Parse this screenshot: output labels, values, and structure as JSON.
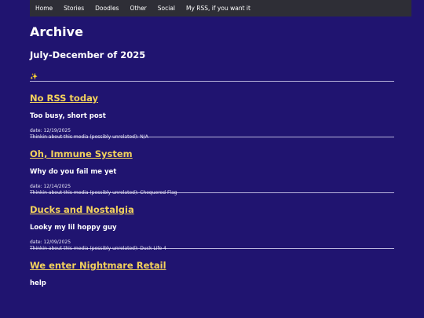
{
  "nav": [
    "Home",
    "Stories",
    "Doodles",
    "Other",
    "Social",
    "My RSS, if you want it"
  ],
  "page": {
    "title": "Archive",
    "subtitle": "July-December of 2025",
    "sparkle": "✨"
  },
  "posts": [
    {
      "title": "No RSS today",
      "subtitle": "Too busy, short post",
      "date": "date: 12/19/2025",
      "media": "Thinkin about this media (possibly unrelated): N/A"
    },
    {
      "title": "Oh, Immune System",
      "subtitle": "Why do you fail me yet",
      "date": "date: 12/14/2025",
      "media": "Thinkin about this media (possibly unrelated): Chequered Flag"
    },
    {
      "title": "Ducks and Nostalgia",
      "subtitle": "Looky my lil hoppy guy",
      "date": "date: 12/09/2025",
      "media": "Thinkin about this media (possibly unrelated): Duck Life 4"
    },
    {
      "title": "We enter Nightmare Retail",
      "subtitle": "help",
      "date": "",
      "media": ""
    }
  ]
}
